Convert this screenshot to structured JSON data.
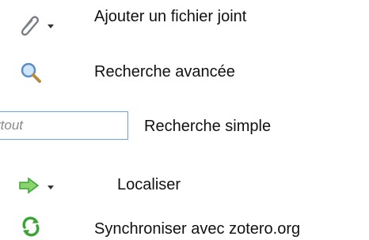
{
  "rows": [
    {
      "icon": "paperclip-icon",
      "has_dropdown": true,
      "label": "Ajouter un fichier joint"
    },
    {
      "icon": "magnifier-icon",
      "has_dropdown": false,
      "label": "Recherche avancée"
    },
    {
      "icon": "search-field",
      "label": "Recherche simple",
      "search_placeholder": "rtout"
    },
    {
      "icon": "green-arrow-right-icon",
      "has_dropdown": true,
      "label": "Localiser"
    },
    {
      "icon": "sync-icon",
      "has_dropdown": false,
      "label": "Synchroniser avec zotero.org"
    }
  ],
  "colors": {
    "text": "#111111",
    "search_border": "#6aa3e2",
    "placeholder": "#8a8a8a",
    "green": "#3aa534"
  }
}
